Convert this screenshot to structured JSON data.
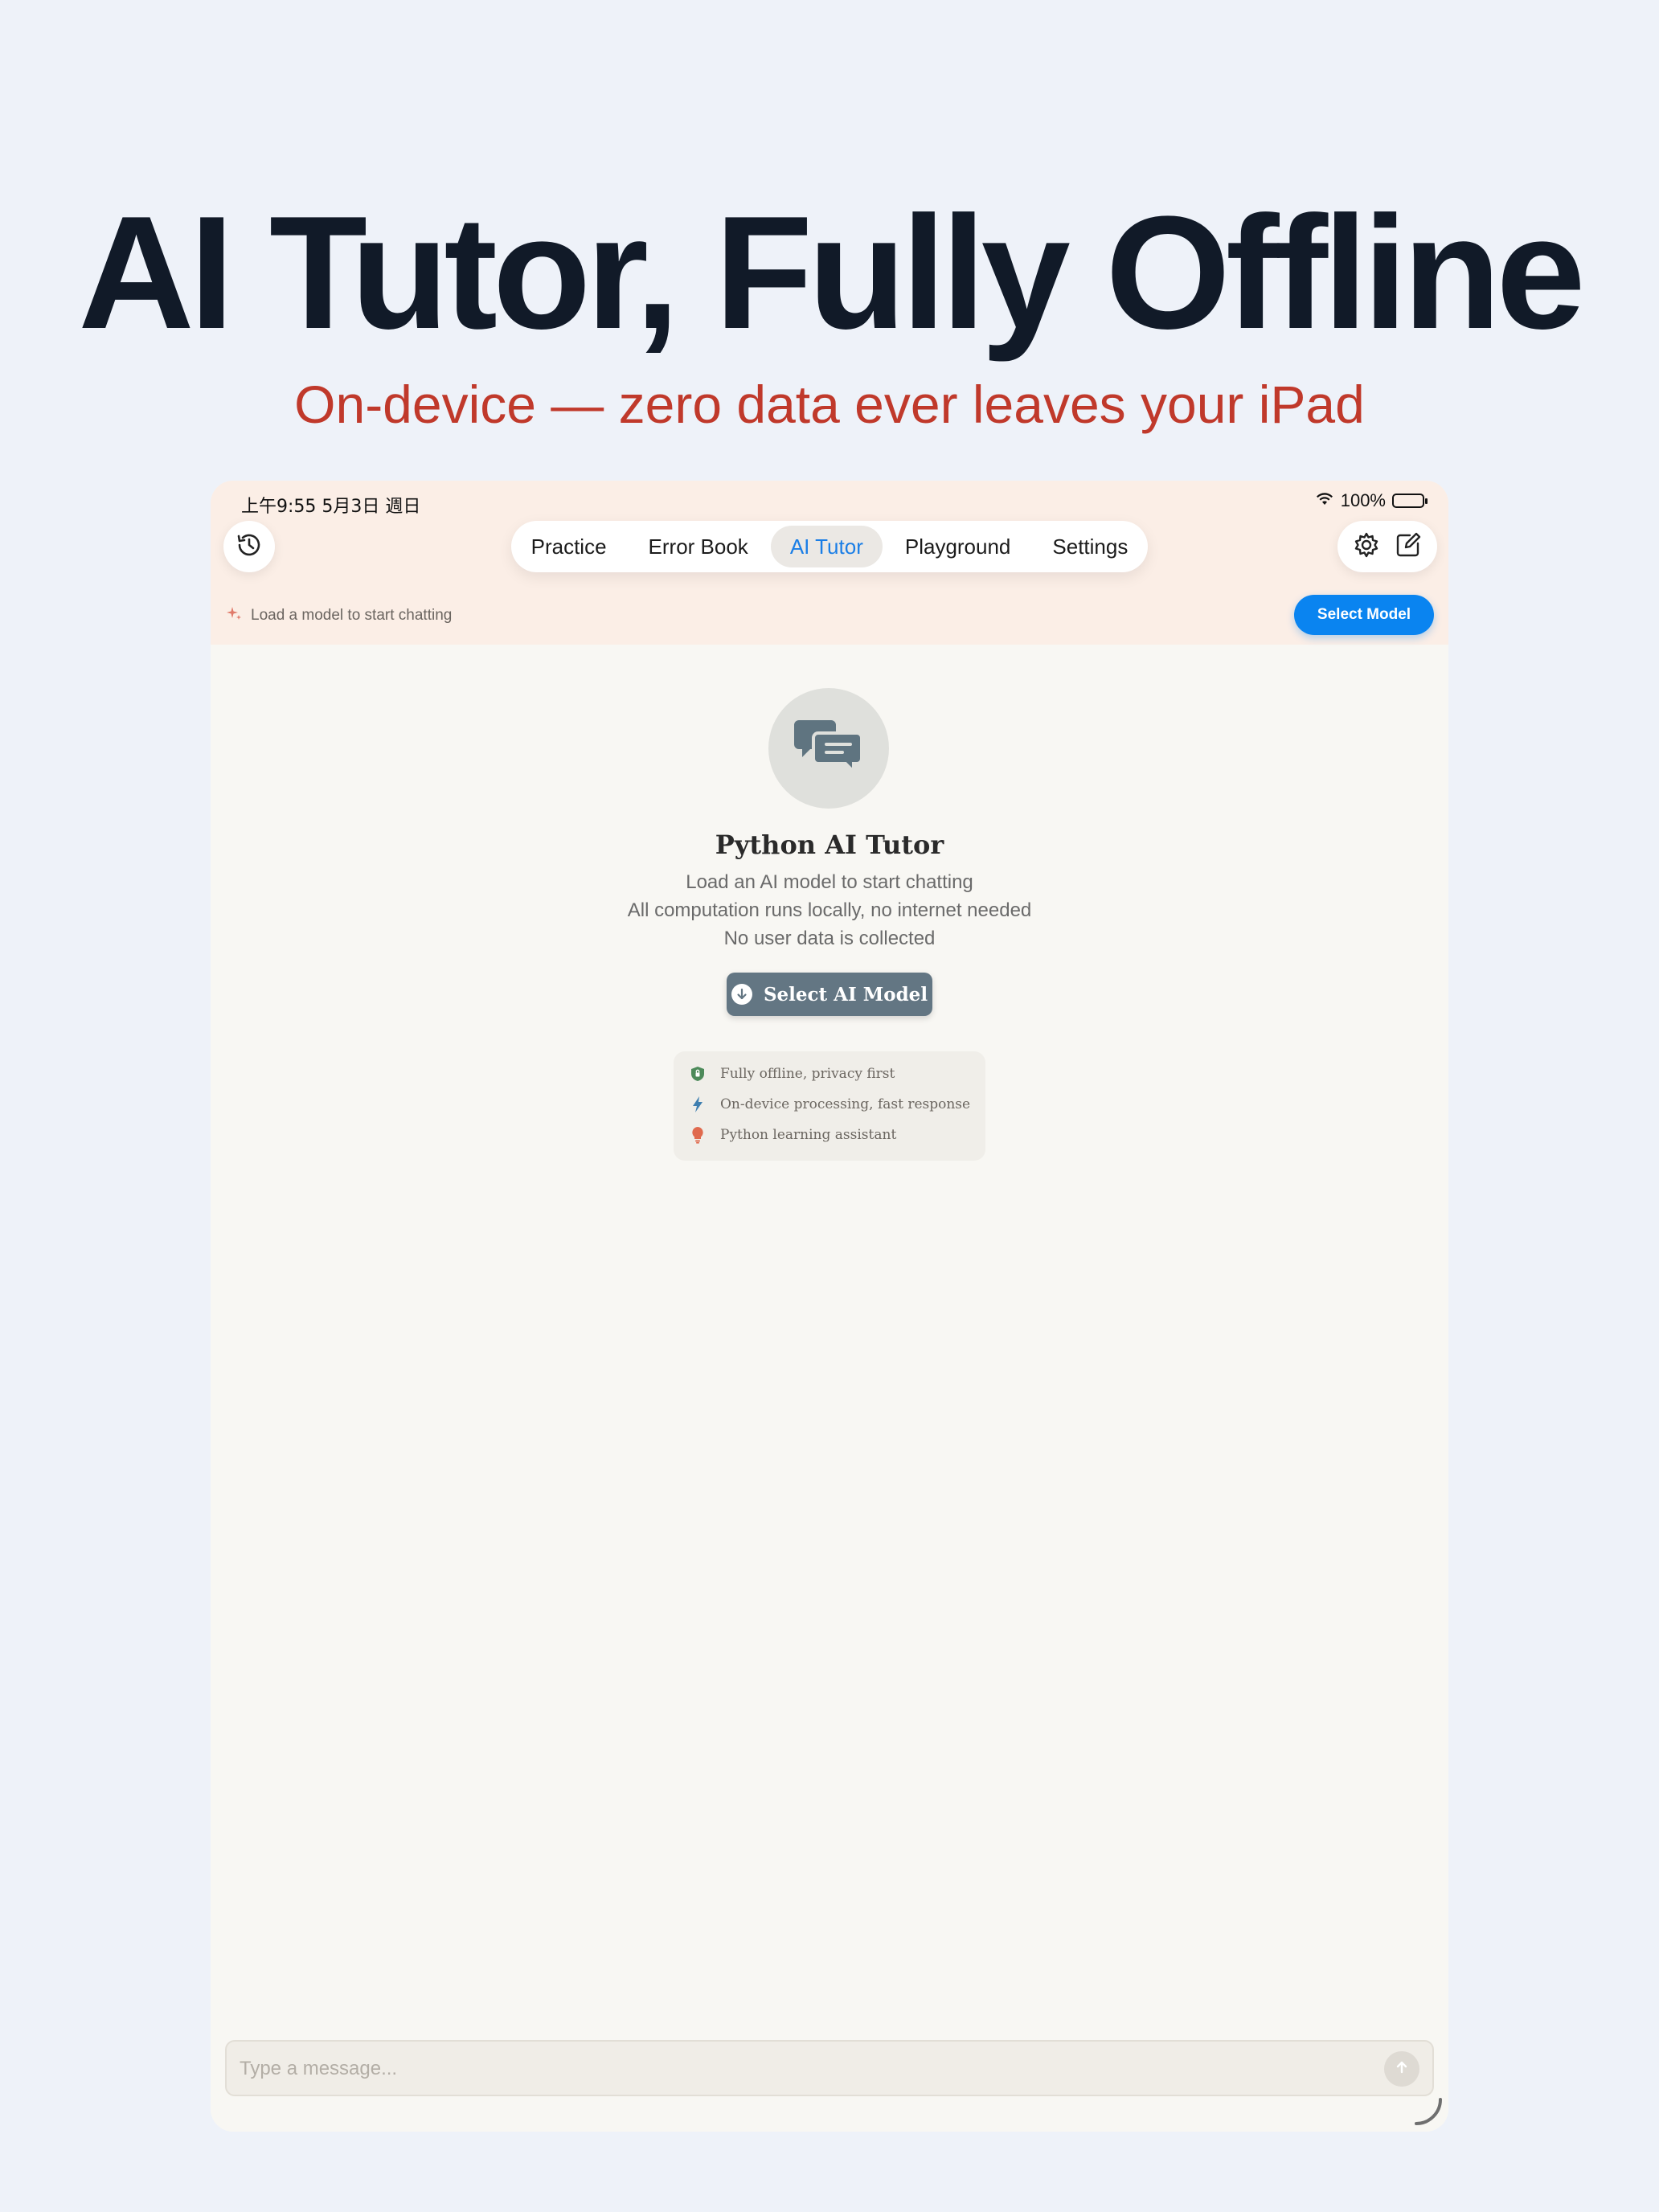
{
  "headline": "AI Tutor, Fully Offline",
  "subheadline": "On-device — zero data ever leaves your iPad",
  "status_bar": {
    "time_date": "上午9:55   5月3日 週日",
    "battery": "100%"
  },
  "tabs": [
    {
      "label": "Practice",
      "active": false
    },
    {
      "label": "Error Book",
      "active": false
    },
    {
      "label": "AI Tutor",
      "active": true
    },
    {
      "label": "Playground",
      "active": false
    },
    {
      "label": "Settings",
      "active": false
    }
  ],
  "model_hint": "Load a model to start chatting",
  "select_model_label": "Select Model",
  "empty_state": {
    "title": "Python AI Tutor",
    "lines": [
      "Load an AI model to start chatting",
      "All computation runs locally, no internet needed",
      "No user data is collected"
    ],
    "button_label": "Select AI Model"
  },
  "features": [
    {
      "icon": "shield-icon",
      "text": "Fully offline, privacy first"
    },
    {
      "icon": "lightning-icon",
      "text": "On-device processing, fast response"
    },
    {
      "icon": "lightbulb-icon",
      "text": "Python learning assistant"
    }
  ],
  "composer": {
    "placeholder": "Type a message..."
  },
  "colors": {
    "accent": "#0a84f0",
    "headline": "#111a28",
    "subheadline": "#c0392b"
  }
}
